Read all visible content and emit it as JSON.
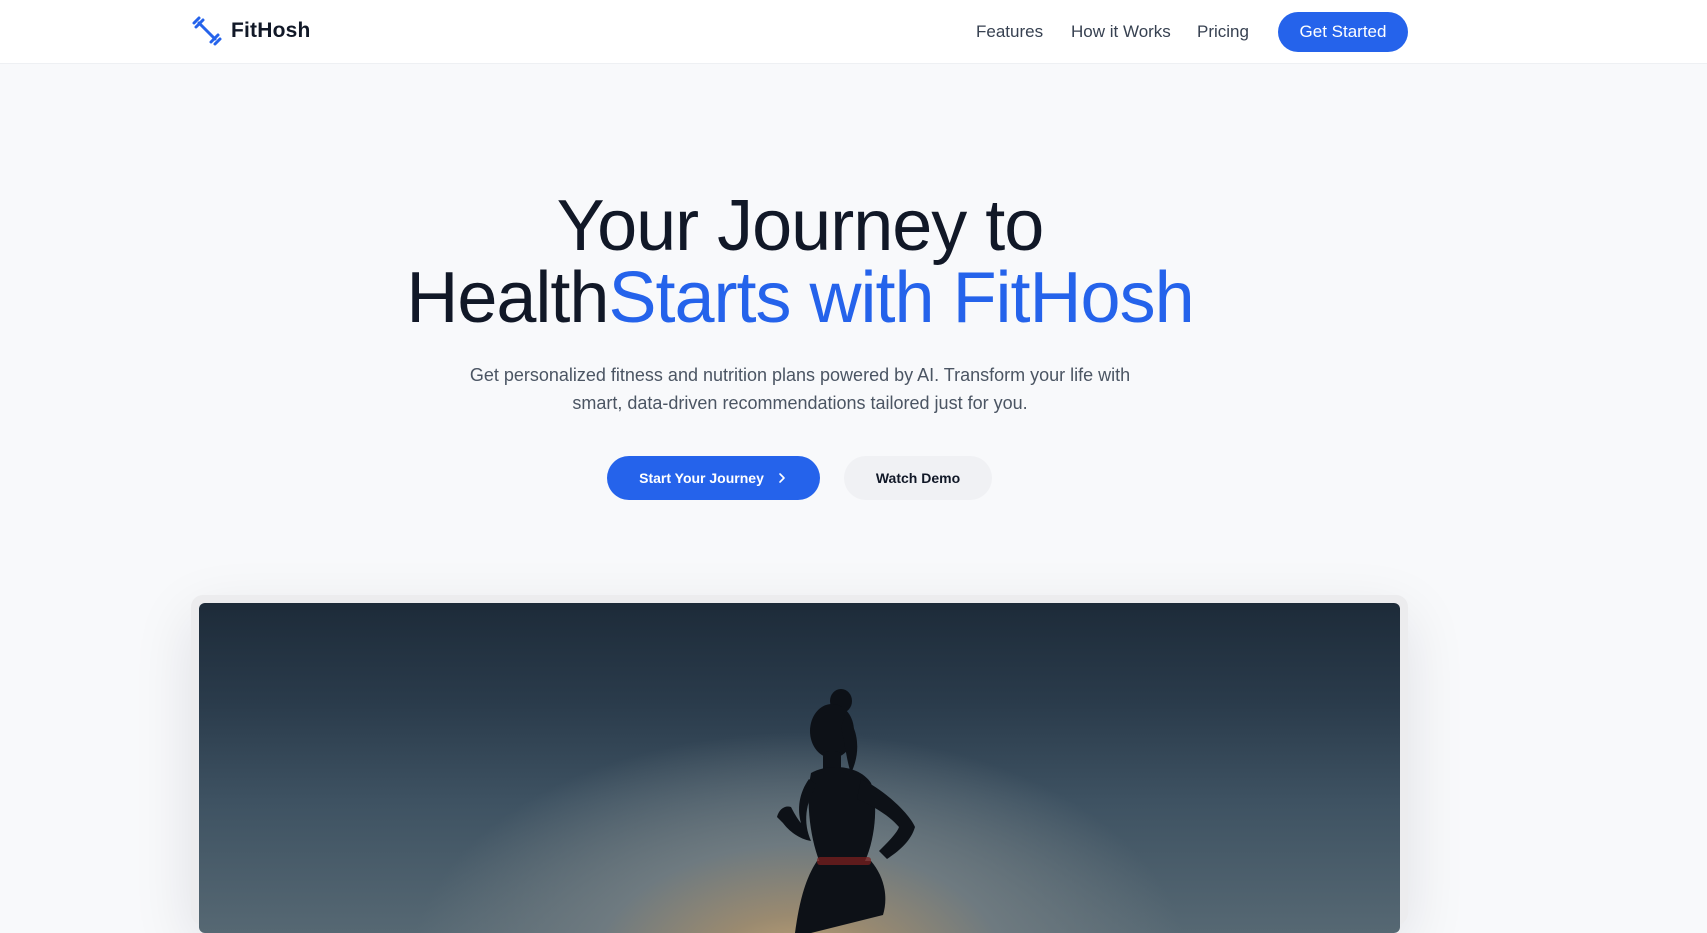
{
  "header": {
    "brand_name": "FitHosh",
    "brand_icon": "dumbbell-icon",
    "nav": [
      {
        "label": "Features"
      },
      {
        "label": "How it Works"
      },
      {
        "label": "Pricing"
      }
    ],
    "cta_label": "Get Started"
  },
  "hero": {
    "title_line1": "Your Journey to",
    "title_line2_plain": "Health",
    "title_line2_accent": "Starts with FitHosh",
    "subtitle_line1": "Get personalized fitness and nutrition plans powered by AI. Transform your life with",
    "subtitle_line2": "smart, data-driven recommendations tailored just for you.",
    "primary_button": "Start Your Journey",
    "primary_button_icon": "chevron-right-icon",
    "secondary_button": "Watch Demo",
    "image_subject": "runner-silhouette-image"
  },
  "colors": {
    "accent": "#2563eb",
    "text_dark": "#111827",
    "text_muted": "#4b5563",
    "page_bg": "#f8f9fb"
  }
}
